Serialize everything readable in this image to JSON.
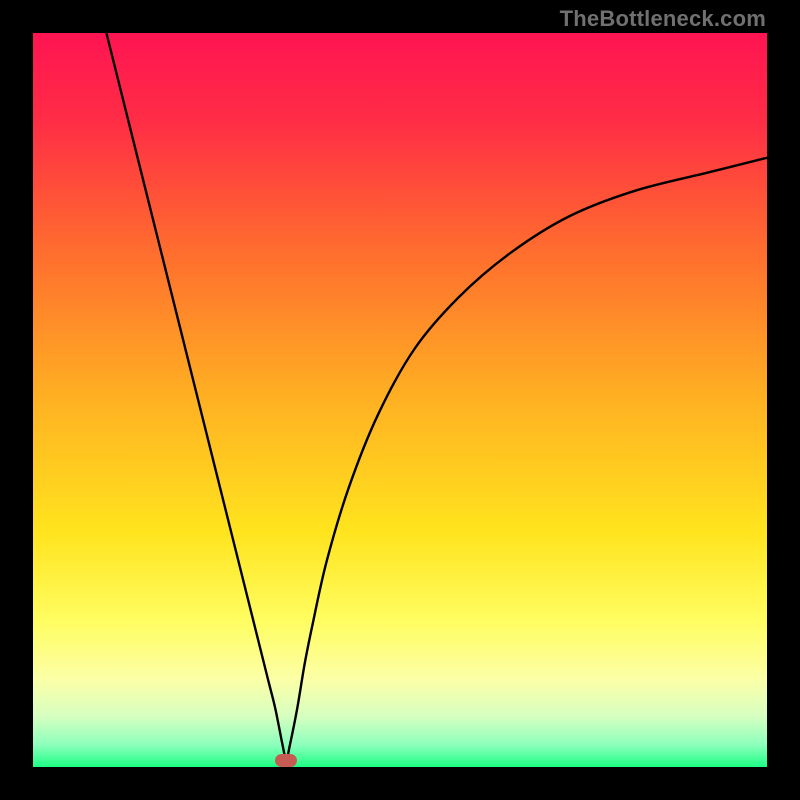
{
  "watermark": "TheBottleneck.com",
  "colors": {
    "bg_black": "#000000",
    "grad_top": "#ff1452",
    "grad_mid1": "#ff5e33",
    "grad_mid2": "#ffb81f",
    "grad_mid3": "#ffe41e",
    "grad_mid4": "#fffd60",
    "grad_mid5": "#eaffb4",
    "grad_bottom": "#1eff84",
    "curve": "#000000",
    "marker": "#c65b53"
  },
  "chart_data": {
    "type": "line",
    "title": "",
    "xlabel": "",
    "ylabel": "",
    "xlim": [
      0,
      100
    ],
    "ylim": [
      0,
      100
    ],
    "marker": {
      "x": 34.5,
      "y": 1.0
    },
    "series": [
      {
        "name": "bottleneck-curve",
        "x": [
          10,
          15,
          20,
          25,
          30,
          32,
          33,
          34,
          34.5,
          35,
          36,
          37,
          38,
          40,
          43,
          47,
          52,
          58,
          65,
          73,
          82,
          92,
          100
        ],
        "values": [
          100,
          80,
          60,
          40,
          20,
          12,
          8,
          3,
          1,
          3,
          8,
          14,
          19,
          28,
          38,
          48,
          57,
          64,
          70,
          75,
          78.5,
          81,
          83
        ]
      }
    ],
    "background_gradient": {
      "stops": [
        {
          "offset": 0.0,
          "color": "#ff1452"
        },
        {
          "offset": 0.12,
          "color": "#ff2d45"
        },
        {
          "offset": 0.3,
          "color": "#ff6e2e"
        },
        {
          "offset": 0.5,
          "color": "#ffb122"
        },
        {
          "offset": 0.68,
          "color": "#ffe41e"
        },
        {
          "offset": 0.8,
          "color": "#fffd60"
        },
        {
          "offset": 0.88,
          "color": "#fcffa6"
        },
        {
          "offset": 0.93,
          "color": "#d7ffc0"
        },
        {
          "offset": 0.97,
          "color": "#8cffbb"
        },
        {
          "offset": 1.0,
          "color": "#1eff84"
        }
      ]
    }
  }
}
